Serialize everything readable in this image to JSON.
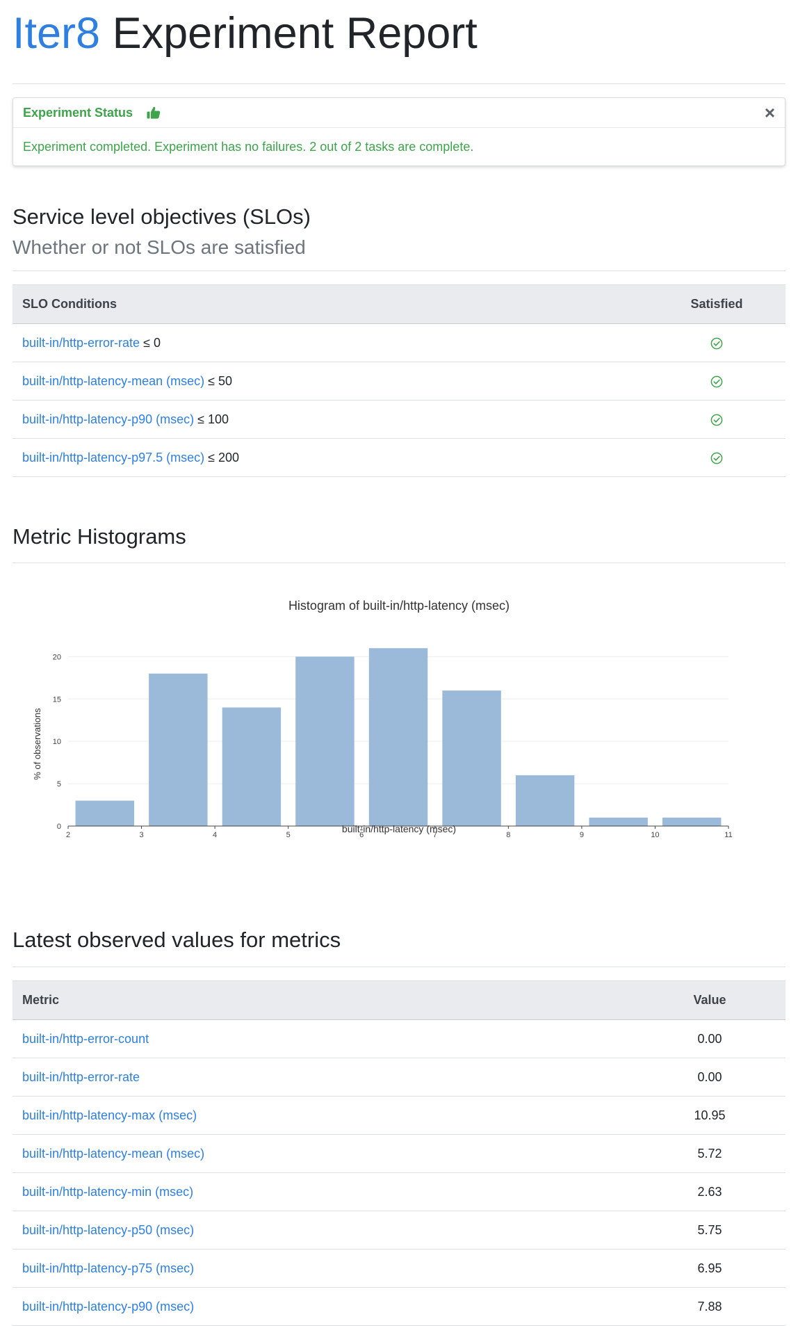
{
  "header": {
    "brand": "Iter8",
    "title_rest": " Experiment Report"
  },
  "status": {
    "title": "Experiment Status",
    "message": "Experiment completed. Experiment has no failures. 2 out of 2 tasks are complete.",
    "close_glyph": "×",
    "color": "#3ea34a"
  },
  "slo": {
    "title": "Service level objectives (SLOs)",
    "subtitle": "Whether or not SLOs are satisfied",
    "columns": [
      "SLO Conditions",
      "Satisfied"
    ],
    "rows": [
      {
        "metric": "built-in/http-error-rate",
        "condition": " ≤ 0",
        "satisfied": "check-circle-icon"
      },
      {
        "metric": "built-in/http-latency-mean (msec)",
        "condition": " ≤ 50",
        "satisfied": "check-circle-icon"
      },
      {
        "metric": "built-in/http-latency-p90 (msec)",
        "condition": " ≤ 100",
        "satisfied": "check-circle-icon"
      },
      {
        "metric": "built-in/http-latency-p97.5 (msec)",
        "condition": " ≤ 200",
        "satisfied": "check-circle-icon"
      }
    ]
  },
  "histograms": {
    "title": "Metric Histograms"
  },
  "chart_data": {
    "type": "bar",
    "title": "Histogram of built-in/http-latency (msec)",
    "xlabel": "built-in/http-latency (msec)",
    "ylabel": "% of observations",
    "bins": [
      {
        "start": 2,
        "end": 3,
        "value": 3
      },
      {
        "start": 3,
        "end": 4,
        "value": 18
      },
      {
        "start": 4,
        "end": 5,
        "value": 14
      },
      {
        "start": 5,
        "end": 6,
        "value": 20
      },
      {
        "start": 6,
        "end": 7,
        "value": 21
      },
      {
        "start": 7,
        "end": 8,
        "value": 16
      },
      {
        "start": 8,
        "end": 9,
        "value": 6
      },
      {
        "start": 9,
        "end": 10,
        "value": 1
      },
      {
        "start": 10,
        "end": 11,
        "value": 1
      }
    ],
    "xticks": [
      2,
      3,
      4,
      5,
      6,
      7,
      8,
      9,
      10,
      11
    ],
    "yticks": [
      0,
      5,
      10,
      15,
      20
    ],
    "xlim": [
      2,
      11
    ],
    "ylim": [
      0,
      22
    ],
    "grid": true,
    "bar_color": "#9bb9d9"
  },
  "latest": {
    "title": "Latest observed values for metrics",
    "columns": [
      "Metric",
      "Value"
    ],
    "rows": [
      {
        "metric": "built-in/http-error-count",
        "value": "0.00"
      },
      {
        "metric": "built-in/http-error-rate",
        "value": "0.00"
      },
      {
        "metric": "built-in/http-latency-max (msec)",
        "value": "10.95"
      },
      {
        "metric": "built-in/http-latency-mean (msec)",
        "value": "5.72"
      },
      {
        "metric": "built-in/http-latency-min (msec)",
        "value": "2.63"
      },
      {
        "metric": "built-in/http-latency-p50 (msec)",
        "value": "5.75"
      },
      {
        "metric": "built-in/http-latency-p75 (msec)",
        "value": "6.95"
      },
      {
        "metric": "built-in/http-latency-p90 (msec)",
        "value": "7.88"
      }
    ]
  }
}
